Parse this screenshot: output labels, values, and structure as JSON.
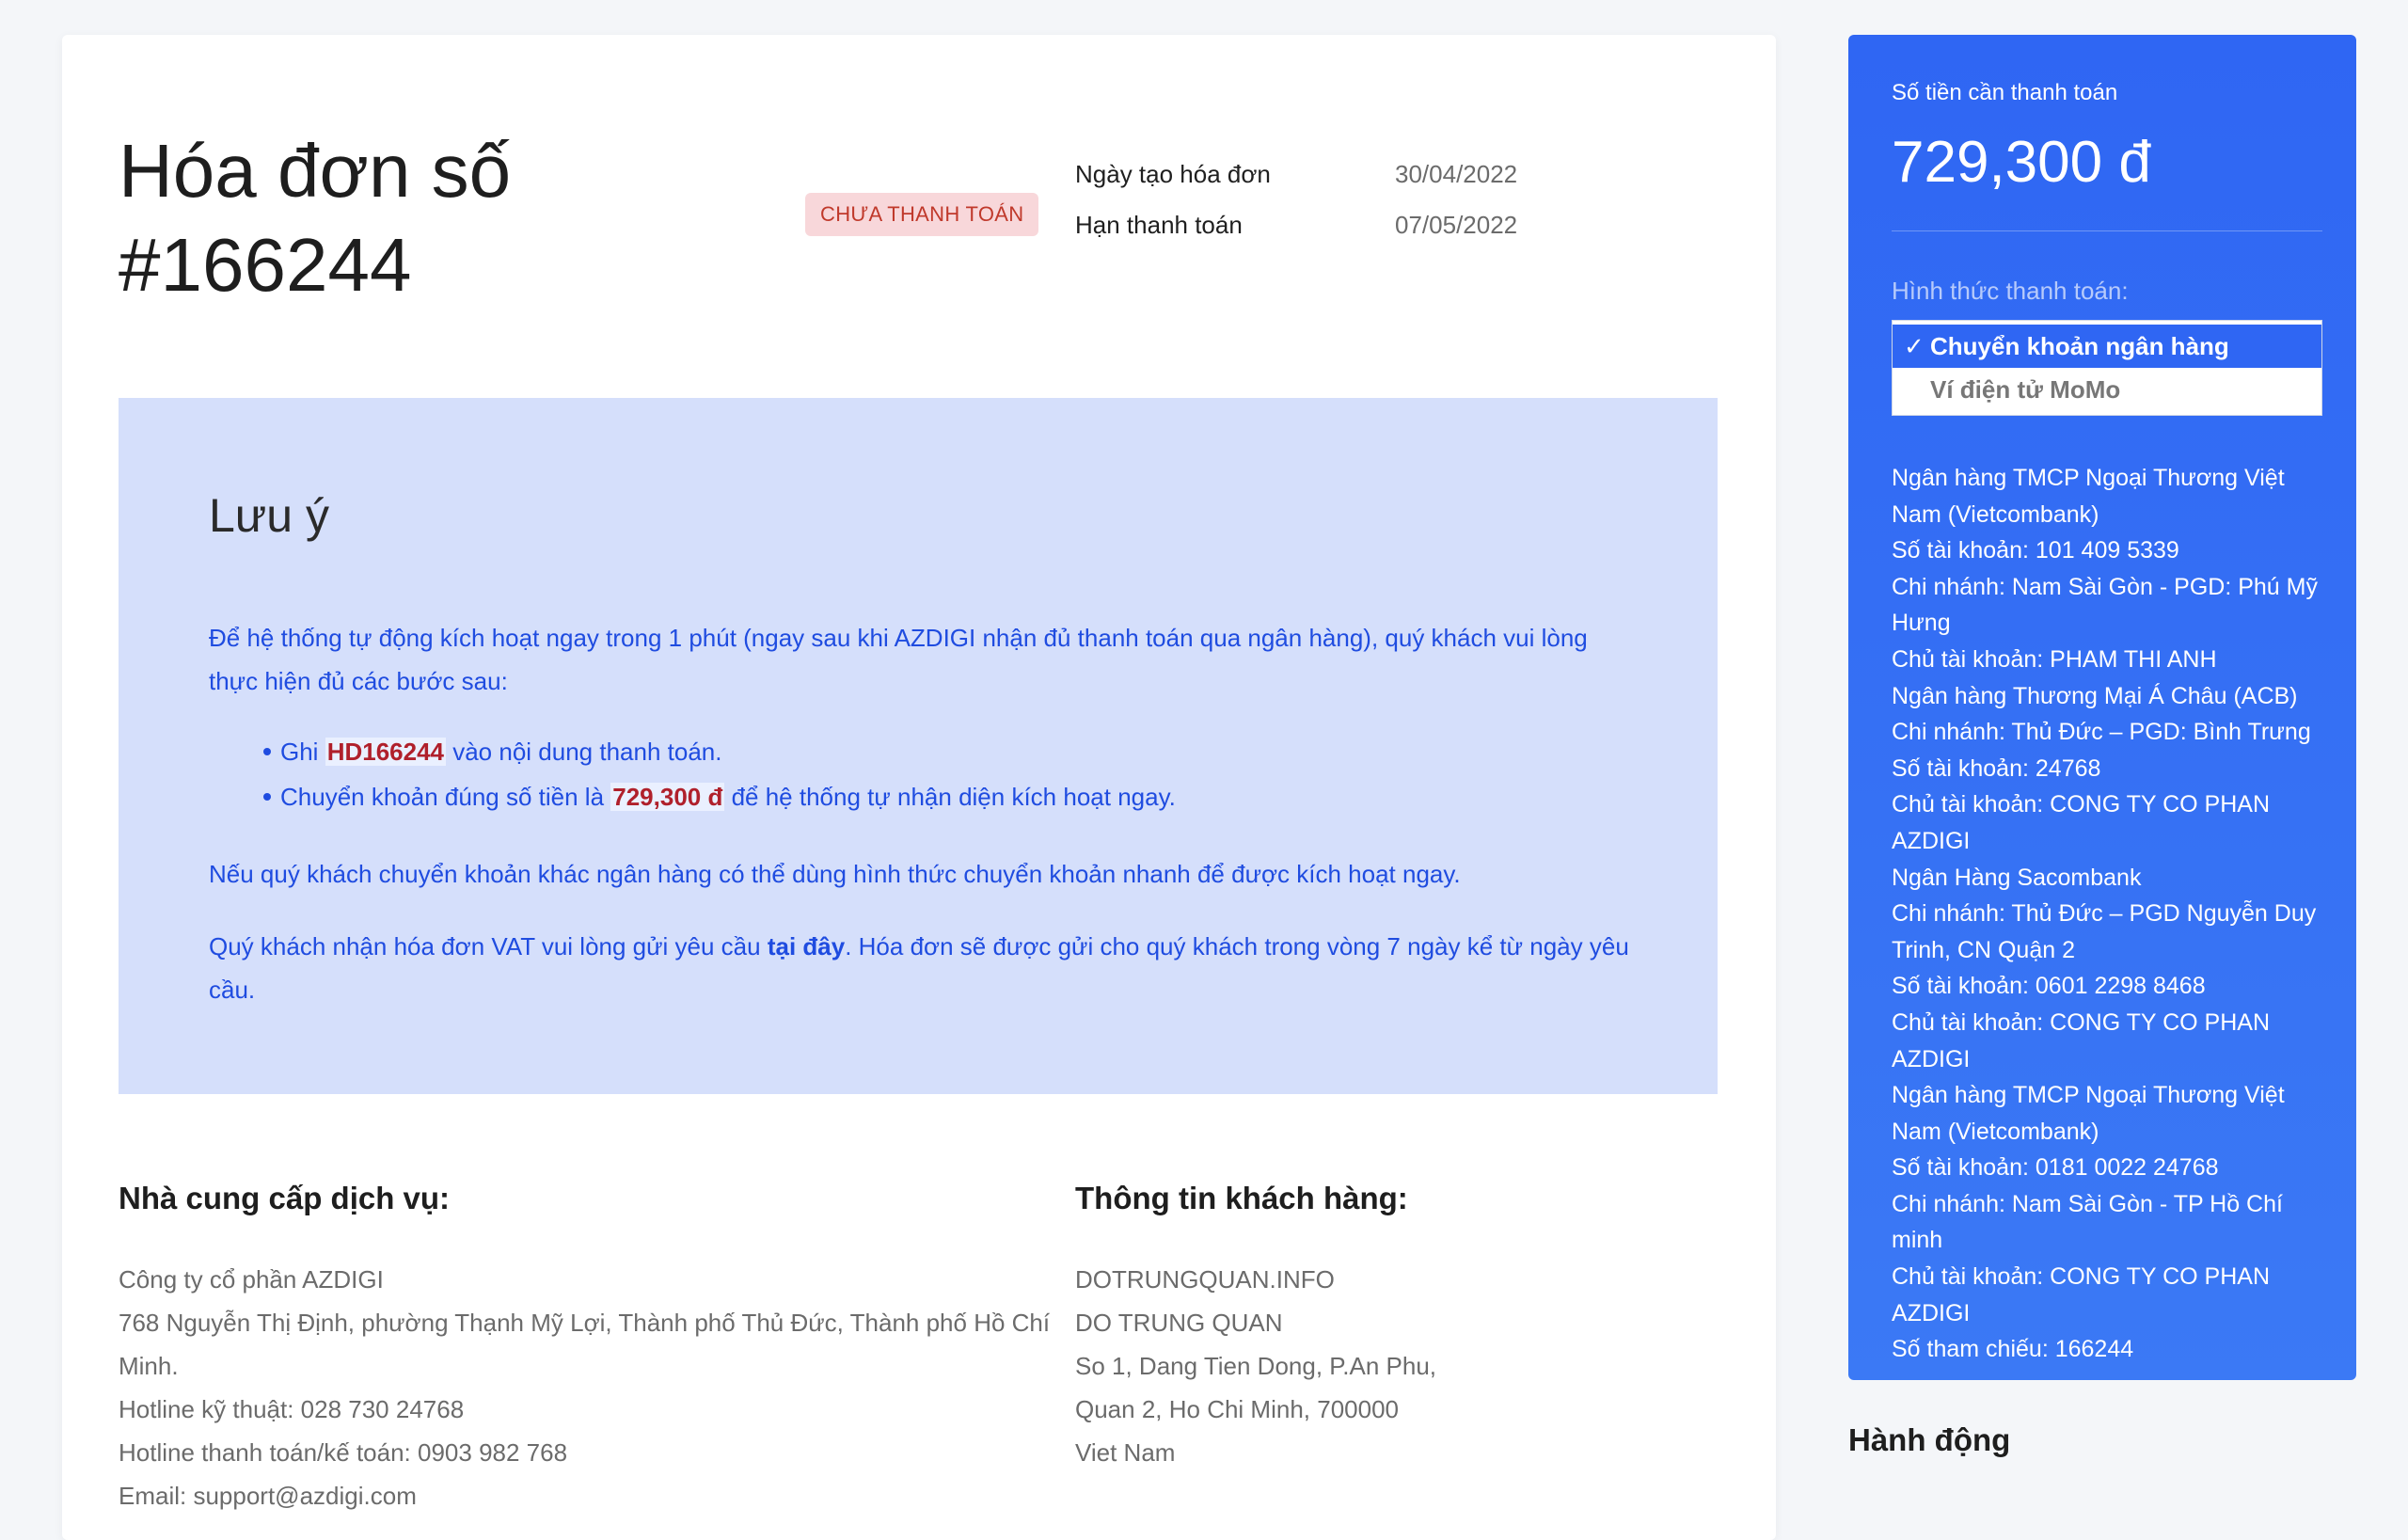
{
  "invoice": {
    "title_line1": "Hóa đơn số",
    "title_line2": "#166244",
    "status": "CHƯA THANH TOÁN",
    "created_label": "Ngày tạo hóa đơn",
    "created_value": "30/04/2022",
    "due_label": "Hạn thanh toán",
    "due_value": "07/05/2022"
  },
  "notice": {
    "title": "Lưu ý",
    "paragraph1": "Để hệ thống tự động kích hoạt ngay trong 1 phút (ngay sau khi AZDIGI nhận đủ thanh toán qua ngân hàng), quý khách vui lòng thực hiện đủ các bước sau:",
    "bullet1_prefix": "Ghi ",
    "bullet1_code": "HD166244",
    "bullet1_suffix": " vào nội dung thanh toán.",
    "bullet2_prefix": "Chuyển khoản đúng số tiền là ",
    "bullet2_amount": "729,300 đ",
    "bullet2_suffix": " để hệ thống tự nhận diện kích hoạt ngay.",
    "paragraph2": "Nếu quý khách chuyển khoản khác ngân hàng có thể dùng hình thức chuyển khoản nhanh để được kích hoạt ngay.",
    "paragraph3_prefix": "Quý khách nhận hóa đơn VAT vui lòng gửi yêu cầu ",
    "paragraph3_link": "tại đây",
    "paragraph3_suffix": ". Hóa đơn sẽ được gửi cho quý khách trong vòng 7 ngày kể từ ngày yêu cầu."
  },
  "provider": {
    "heading": "Nhà cung cấp dịch vụ:",
    "lines": [
      "Công ty cổ phần AZDIGI",
      "768 Nguyễn Thị Định, phường Thạnh Mỹ Lợi, Thành phố Thủ Đức, Thành phố Hồ Chí Minh.",
      "Hotline kỹ thuật: 028 730 24768",
      "Hotline thanh toán/kế toán: 0903 982 768",
      "Email: support@azdigi.com"
    ]
  },
  "customer": {
    "heading": "Thông tin khách hàng:",
    "lines": [
      "DOTRUNGQUAN.INFO",
      "DO TRUNG QUAN",
      "So 1, Dang Tien Dong, P.An Phu,",
      "Quan 2, Ho Chi Minh, 700000",
      "Viet Nam"
    ]
  },
  "payment": {
    "amount_label": "Số tiền cần thanh toán",
    "amount": "729,300 đ",
    "method_label": "Hình thức thanh toán:",
    "options": [
      {
        "check": "✓",
        "label": "Chuyển khoản ngân hàng"
      },
      {
        "label": "Ví điện tử MoMo"
      }
    ],
    "bank_lines": [
      "Ngân hàng TMCP Ngoại Thương Việt Nam (Vietcombank)",
      "Số tài khoản: 101 409 5339",
      "Chi nhánh: Nam Sài Gòn - PGD: Phú Mỹ Hưng",
      "Chủ tài khoản: PHAM THI ANH",
      "Ngân hàng Thương Mại Á Châu (ACB)",
      "Chi nhánh: Thủ Đức – PGD: Bình Trưng",
      "Số tài khoản: 24768",
      "Chủ tài khoản: CONG TY CO PHAN AZDIGI",
      "Ngân Hàng Sacombank",
      "Chi nhánh: Thủ Đức – PGD Nguyễn Duy Trinh, CN Quận 2",
      "Số tài khoản: 0601 2298 8468",
      "Chủ tài khoản: CONG TY CO PHAN AZDIGI",
      "Ngân hàng TMCP Ngoại Thương Việt Nam (Vietcombank)",
      "Số tài khoản: 0181 0022 24768",
      "Chi nhánh: Nam Sài Gòn - TP Hồ Chí minh",
      "Chủ tài khoản: CONG TY CO PHAN AZDIGI",
      "Số tham chiếu: 166244"
    ]
  },
  "actions": {
    "heading": "Hành động"
  },
  "colors": {
    "accent": "#2f66f3",
    "notice_bg": "#d5dffb",
    "notice_text": "#1f4ce0",
    "badge_bg": "#f8d7da",
    "badge_text": "#c0392b",
    "highlight": "#b0202b"
  }
}
